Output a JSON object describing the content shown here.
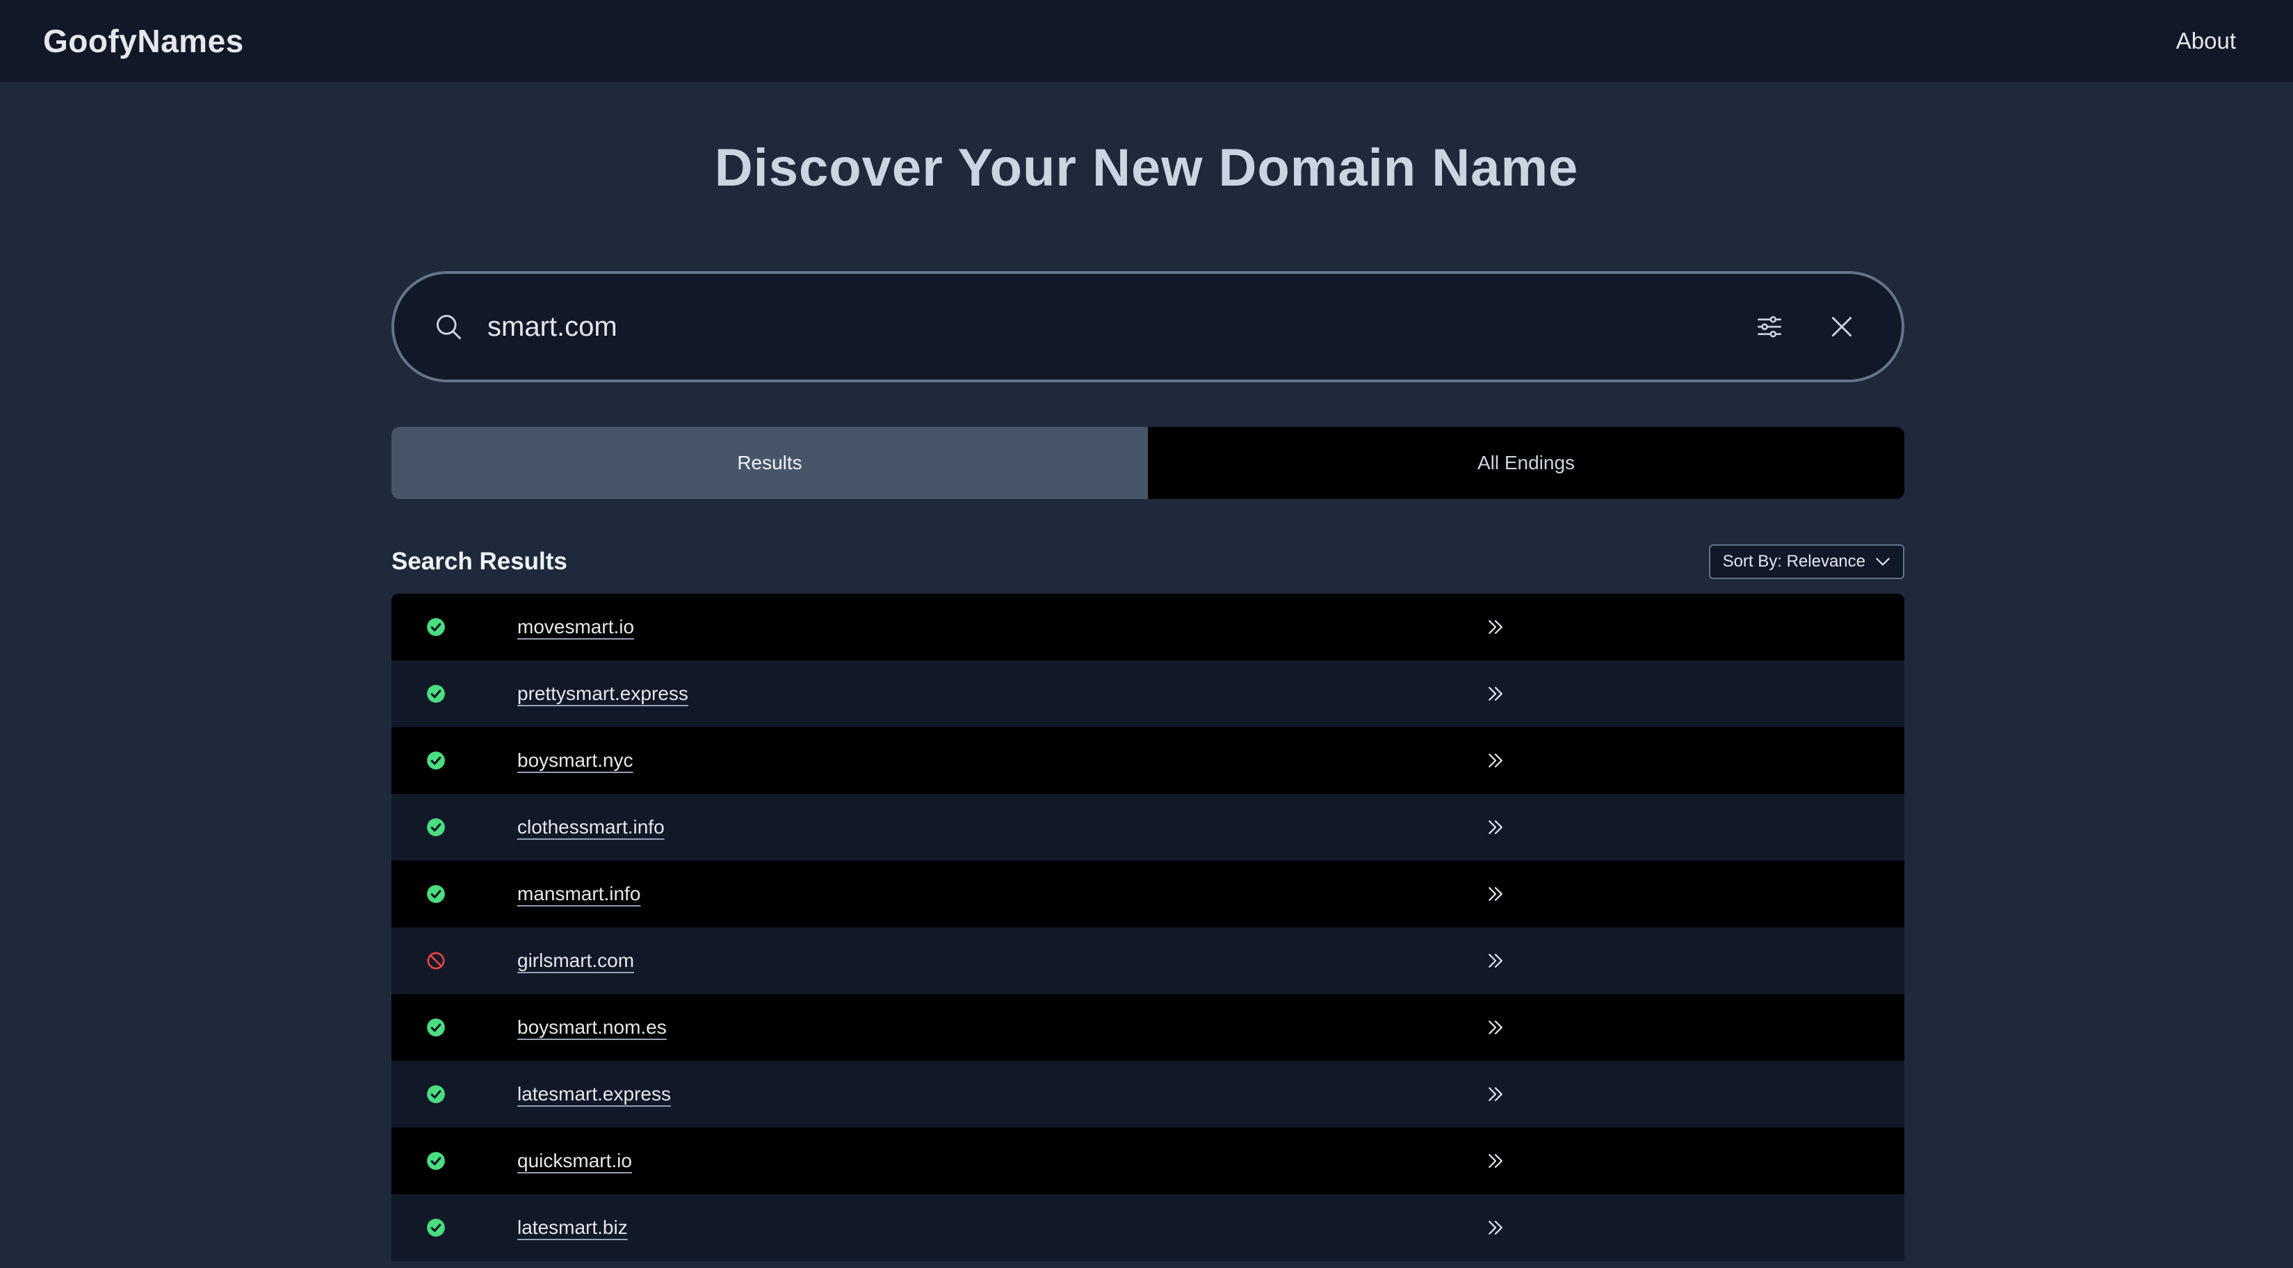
{
  "header": {
    "logo": "GoofyNames",
    "about_label": "About"
  },
  "hero": {
    "title": "Discover Your New Domain Name"
  },
  "search": {
    "value": "smart.com"
  },
  "tabs": [
    {
      "label": "Results",
      "active": true
    },
    {
      "label": "All Endings",
      "active": false
    }
  ],
  "results": {
    "title": "Search Results",
    "sort_label": "Sort By: Relevance",
    "items": [
      {
        "domain": "movesmart.io",
        "status": "available"
      },
      {
        "domain": "prettysmart.express",
        "status": "available"
      },
      {
        "domain": "boysmart.nyc",
        "status": "available"
      },
      {
        "domain": "clothessmart.info",
        "status": "available"
      },
      {
        "domain": "mansmart.info",
        "status": "available"
      },
      {
        "domain": "girlsmart.com",
        "status": "unavailable"
      },
      {
        "domain": "boysmart.nom.es",
        "status": "available"
      },
      {
        "domain": "latesmart.express",
        "status": "available"
      },
      {
        "domain": "quicksmart.io",
        "status": "available"
      },
      {
        "domain": "latesmart.biz",
        "status": "available"
      }
    ]
  },
  "colors": {
    "available": "#4ade80",
    "unavailable": "#ef4444",
    "background": "#1e293b",
    "header": "#111827"
  },
  "icons": {
    "search": "search-icon",
    "filter": "sliders-icon",
    "clear": "close-icon",
    "sort": "chevron-down-icon",
    "available": "check-circle-icon",
    "unavailable": "ban-icon",
    "go": "double-chevron-right-icon"
  }
}
